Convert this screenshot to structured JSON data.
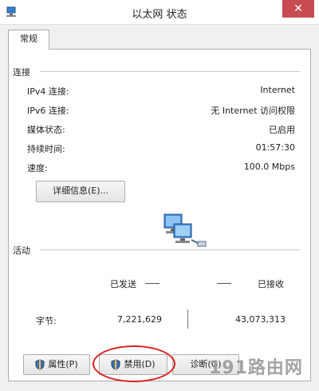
{
  "window": {
    "title": "以太网 状态",
    "close_glyph": "✕"
  },
  "tab": {
    "label": "常规"
  },
  "connection": {
    "section_title": "连接",
    "rows": [
      {
        "label": "IPv4 连接:",
        "value": "Internet"
      },
      {
        "label": "IPv6 连接:",
        "value": "无 Internet 访问权限"
      },
      {
        "label": "媒体状态:",
        "value": "已启用"
      },
      {
        "label": "持续时间:",
        "value": "01:57:30"
      },
      {
        "label": "速度:",
        "value": "100.0 Mbps"
      }
    ],
    "details_button": "详细信息(E)..."
  },
  "activity": {
    "section_title": "活动",
    "sent_label": "已发送",
    "received_label": "已接收",
    "bytes_label": "字节:",
    "bytes_sent": "7,221,629",
    "bytes_received": "43,073,313"
  },
  "buttons": {
    "properties": "属性(P)",
    "disable": "禁用(D)",
    "diagnose": "诊断(G)"
  },
  "watermark": "191路由网",
  "colors": {
    "close": "#c74b50",
    "highlight_ellipse": "#d82020"
  }
}
